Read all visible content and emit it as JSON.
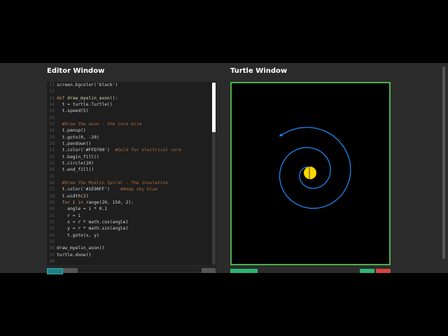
{
  "editor": {
    "title": "Editor Window",
    "lines": [
      {
        "n": "11",
        "html": "screen.bgcolor('black')"
      },
      {
        "n": "12",
        "html": ""
      },
      {
        "n": "13",
        "html": "<span class='kw'>def</span> <span class='fn'>draw_myelin_axon</span>():"
      },
      {
        "n": "14",
        "html": "  t = turtle.Turtle()"
      },
      {
        "n": "15",
        "html": "  t.speed(5)"
      },
      {
        "n": "16",
        "html": ""
      },
      {
        "n": "17",
        "html": "  <span class='cm'>#Draw the axon - the core wire</span>"
      },
      {
        "n": "18",
        "html": "  t.penup()"
      },
      {
        "n": "19",
        "html": "  t.goto(0, -20)"
      },
      {
        "n": "20",
        "html": "  t.pendown()"
      },
      {
        "n": "21",
        "html": "  t.color('#FFD700')  <span class='cm'>#Gold for electrical core</span>"
      },
      {
        "n": "22",
        "html": "  t.begin_fill()"
      },
      {
        "n": "23",
        "html": "  t.circle(20)"
      },
      {
        "n": "24",
        "html": "  t.end_fill()"
      },
      {
        "n": "25",
        "html": ""
      },
      {
        "n": "26",
        "html": "  <span class='cm'>#Draw the Myelin Spiral - The insulation</span>"
      },
      {
        "n": "27",
        "html": "  t.color('#1E90FF')    <span class='cm'>#deep sky blue</span>"
      },
      {
        "n": "28",
        "html": "  t.width(2)"
      },
      {
        "n": "29",
        "html": "  <span class='kw'>for</span> i <span class='kw'>in</span> range(20, 150, 2):"
      },
      {
        "n": "30",
        "html": "    angle = i * 0.1"
      },
      {
        "n": "31",
        "html": "    r = i"
      },
      {
        "n": "32",
        "html": "    x = r * math.cos(angle)"
      },
      {
        "n": "33",
        "html": "    y = r * math.sin(angle)"
      },
      {
        "n": "34",
        "html": "    t.goto(x, y)"
      },
      {
        "n": "35",
        "html": ""
      },
      {
        "n": "36",
        "html": "draw_myelin_axon()"
      },
      {
        "n": "37",
        "html": "turtle.done()"
      },
      {
        "n": "38",
        "html": ""
      }
    ]
  },
  "turtle": {
    "title": "Turtle Window",
    "bg_color": "#000000",
    "border_color": "#4caf50",
    "core_color": "#FFD700",
    "spiral_color": "#1E90FF"
  }
}
